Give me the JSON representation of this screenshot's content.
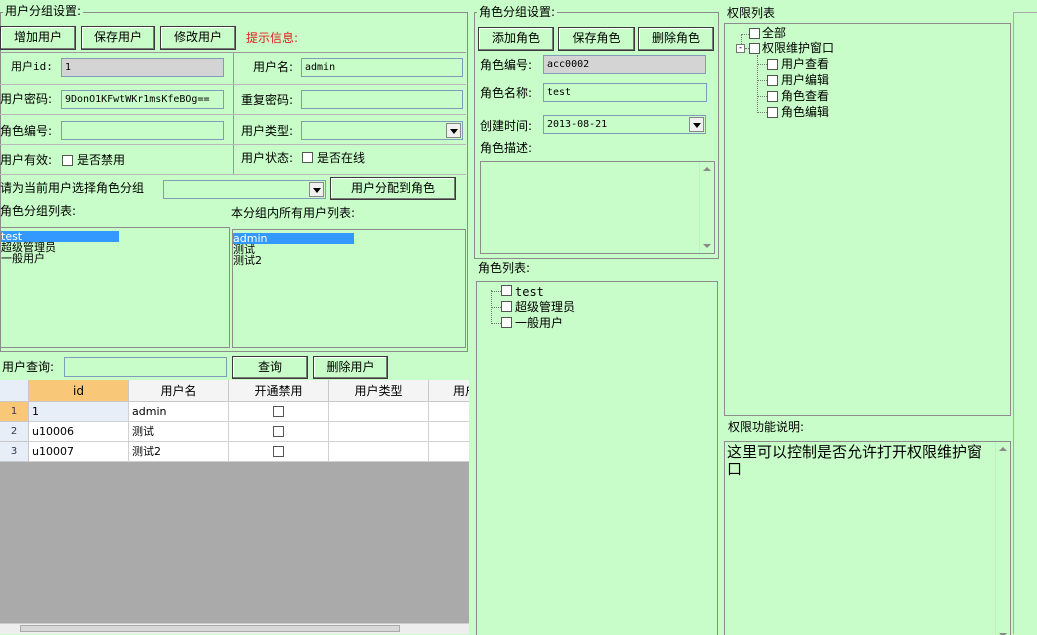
{
  "user_group": {
    "title": "用户分组设置:",
    "add_user": "增加用户",
    "save_user": "保存用户",
    "edit_user": "修改用户",
    "hint": "提示信息:",
    "hint_color": "#e02020",
    "user_id_label": "用户id:",
    "user_id_value": "1",
    "username_label": "用户名:",
    "username_value": "admin",
    "password_label": "用户密码:",
    "password_value": "9DonO1KFwtWKr1msKfeBOg==",
    "repeat_password_label": "重复密码:",
    "repeat_password_value": "",
    "role_no_label": "角色编号:",
    "role_no_value": "",
    "user_type_label": "用户类型:",
    "user_type_value": "",
    "user_valid_label": "用户有效:",
    "disabled_label": "是否禁用",
    "user_status_label": "用户状态:",
    "online_label": "是否在线",
    "assign_prompt": "请为当前用户选择角色分组",
    "assign_combo_value": "",
    "assign_button": "用户分配到角色",
    "role_list_label": "角色分组列表:",
    "role_list": [
      "test",
      "超级管理员",
      "一般用户"
    ],
    "group_users_label": "本分组内所有用户列表:",
    "group_users": [
      "admin",
      "测试",
      "测试2"
    ]
  },
  "user_query": {
    "label": "用户查询:",
    "value": "",
    "query_button": "查询",
    "delete_button": "删除用户"
  },
  "grid": {
    "columns": [
      "id",
      "用户名",
      "开通禁用",
      "用户类型",
      "用户"
    ],
    "rows": [
      {
        "num": "1",
        "id": "1",
        "name": "admin",
        "disabled": false,
        "type": ""
      },
      {
        "num": "2",
        "id": "u10006",
        "name": "测试",
        "disabled": false,
        "type": ""
      },
      {
        "num": "3",
        "id": "u10007",
        "name": "测试2",
        "disabled": false,
        "type": ""
      }
    ]
  },
  "role_group": {
    "title": "角色分组设置:",
    "add_role": "添加角色",
    "save_role": "保存角色",
    "delete_role": "删除角色",
    "role_no_label": "角色编号:",
    "role_no_value": "acc0002",
    "role_name_label": "角色名称:",
    "role_name_value": "test",
    "created_label": "创建时间:",
    "created_value": "2013-08-21",
    "desc_label": "角色描述:",
    "desc_value": ""
  },
  "role_list": {
    "title": "角色列表:",
    "items": [
      "test",
      "超级管理员",
      "一般用户"
    ]
  },
  "permissions": {
    "title": "权限列表",
    "all": "全部",
    "window": "权限维护窗口",
    "children": [
      "用户查看",
      "用户编辑",
      "角色查看",
      "角色编辑"
    ],
    "desc_title": "权限功能说明:",
    "desc_text": "这里可以控制是否允许打开权限维护窗口"
  }
}
